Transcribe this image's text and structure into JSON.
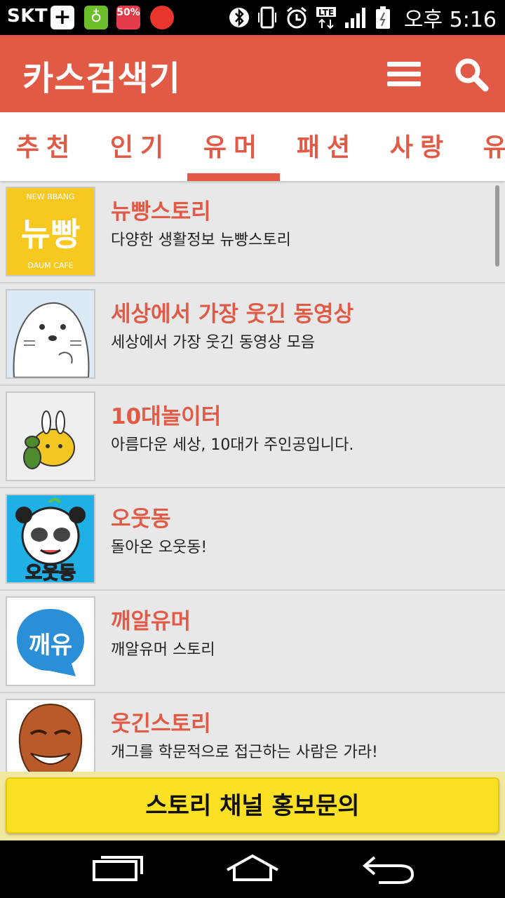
{
  "status_bar": {
    "carrier": "SKT",
    "badge_percent": "50%",
    "network": "LTE",
    "time": "오후 5:16"
  },
  "app_bar": {
    "title": "카스검색기"
  },
  "tabs": [
    {
      "label": "추천",
      "selected": false
    },
    {
      "label": "인기",
      "selected": false
    },
    {
      "label": "유머",
      "selected": true
    },
    {
      "label": "패션",
      "selected": false
    },
    {
      "label": "사랑",
      "selected": false
    },
    {
      "label": "유아",
      "selected": false
    }
  ],
  "list": {
    "items": [
      {
        "title": "뉴빵스토리",
        "description": "다양한 생활정보 뉴빵스토리",
        "thumb_text": "뉴빵",
        "thumb_top": "NEW BBANG",
        "thumb_bottom": "DAUM CAFE"
      },
      {
        "title": "세상에서 가장 웃긴 동영상",
        "description": "세상에서 가장 웃긴 동영상 모음"
      },
      {
        "title": "10대놀이터",
        "description": "아름다운 세상, 10대가 주인공입니다."
      },
      {
        "title": "오웃동",
        "description": "돌아온 오웃동!",
        "thumb_text": "오웃동"
      },
      {
        "title": "깨알유머",
        "description": "깨알유머 스토리",
        "thumb_text": "깨유"
      },
      {
        "title": "웃긴스토리",
        "description": "개그를 학문적으로 접근하는 사람은 가라!"
      }
    ]
  },
  "promo_button": {
    "label": "스토리 채널 홍보문의"
  },
  "colors": {
    "accent": "#e05a45",
    "promo": "#fbe023"
  }
}
